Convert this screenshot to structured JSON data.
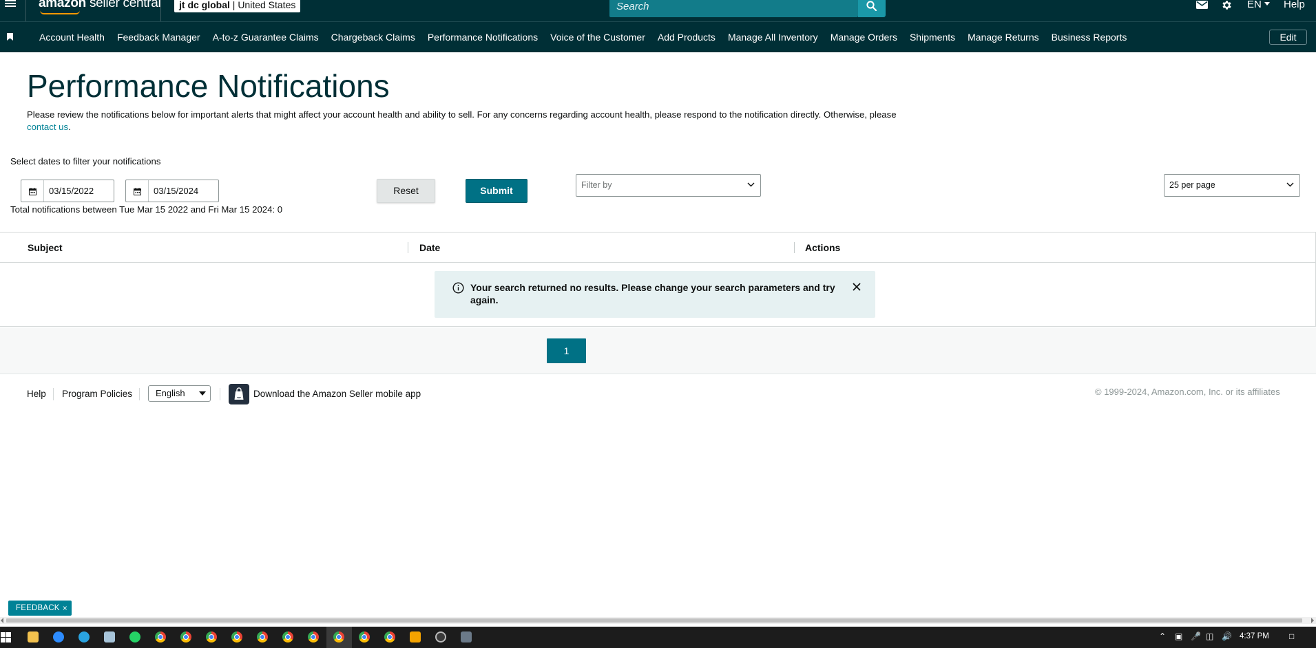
{
  "topbar": {
    "logo_main": "amazon",
    "logo_sub": "seller central",
    "account_name": "jt dc global",
    "account_sep": "|",
    "marketplace": "United States",
    "search_placeholder": "Search",
    "language": "EN",
    "help": "Help"
  },
  "nav": {
    "items": [
      "Account Health",
      "Feedback Manager",
      "A-to-z Guarantee Claims",
      "Chargeback Claims",
      "Performance Notifications",
      "Voice of the Customer",
      "Add Products",
      "Manage All Inventory",
      "Manage Orders",
      "Shipments",
      "Manage Returns",
      "Business Reports"
    ],
    "edit": "Edit"
  },
  "page": {
    "title": "Performance Notifications",
    "intro": "Please review the notifications below for important alerts that might affect your account health and ability to sell. For any concerns regarding account health, please respond to the notification directly. Otherwise, please",
    "contact_link": "contact us",
    "intro_end": "."
  },
  "filters": {
    "label": "Select dates to filter your notifications",
    "start_date": "03/15/2022",
    "end_date": "03/15/2024",
    "reset": "Reset",
    "submit": "Submit",
    "filter_placeholder": "Filter by",
    "per_page": "25 per page",
    "total_text": "Total notifications between Tue Mar 15 2022 and Fri Mar 15 2024: 0"
  },
  "table": {
    "columns": [
      "Subject",
      "Date",
      "Actions"
    ],
    "empty_message": "Your search returned no results. Please change your search parameters and try again."
  },
  "pagination": {
    "current_page": "1"
  },
  "footer": {
    "help": "Help",
    "program_policies": "Program Policies",
    "language_select": "English",
    "app_download": "Download the Amazon Seller mobile app",
    "copyright": "© 1999-2024, Amazon.com, Inc. or its affiliates"
  },
  "feedback": {
    "label": "FEEDBACK",
    "close": "×"
  },
  "taskbar": {
    "time": "4:37 PM"
  },
  "colors": {
    "header_bg": "#002f36",
    "accent": "#007185",
    "link": "#008296",
    "alert_bg": "#e6f1f2"
  }
}
